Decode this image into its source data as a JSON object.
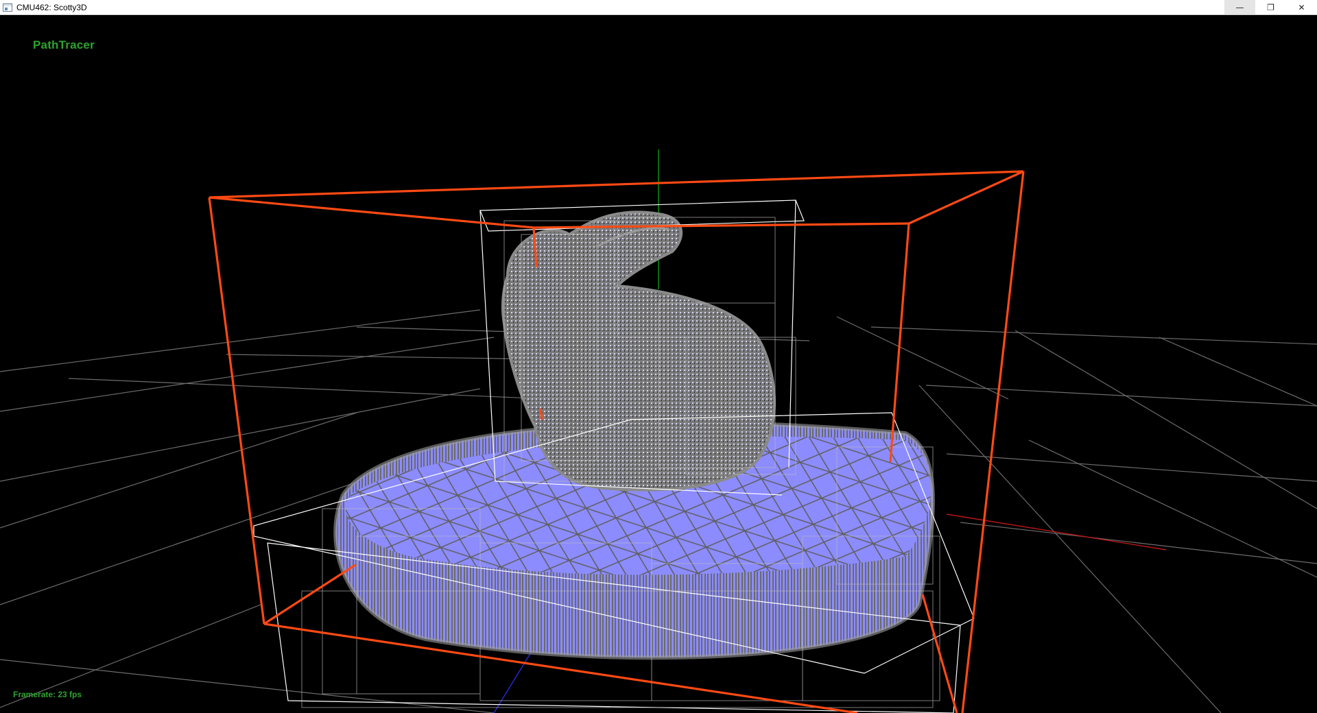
{
  "window": {
    "title": "CMU462: Scotty3D",
    "controls": {
      "minimize": "—",
      "restore": "❐",
      "close": "✕"
    }
  },
  "viewport": {
    "mode_label": "PathTracer",
    "framerate_text": "Framerate: 23 fps",
    "colors": {
      "background": "#000000",
      "grid": "#808080",
      "bvh_root_box": "#ff4a14",
      "bvh_node_box": "#ffffff",
      "mesh_wire": "#8f8f8f",
      "mesh_fill": "#8c8cff",
      "axis_x": "#c01818",
      "axis_y": "#0d9a0d",
      "axis_z": "#2828d8",
      "hud_text": "#2fa32f"
    },
    "objects": [
      "ground-grid",
      "bvh-root-box",
      "bvh-node-boxes",
      "bunny-mesh",
      "platform-mesh",
      "world-axes"
    ]
  }
}
